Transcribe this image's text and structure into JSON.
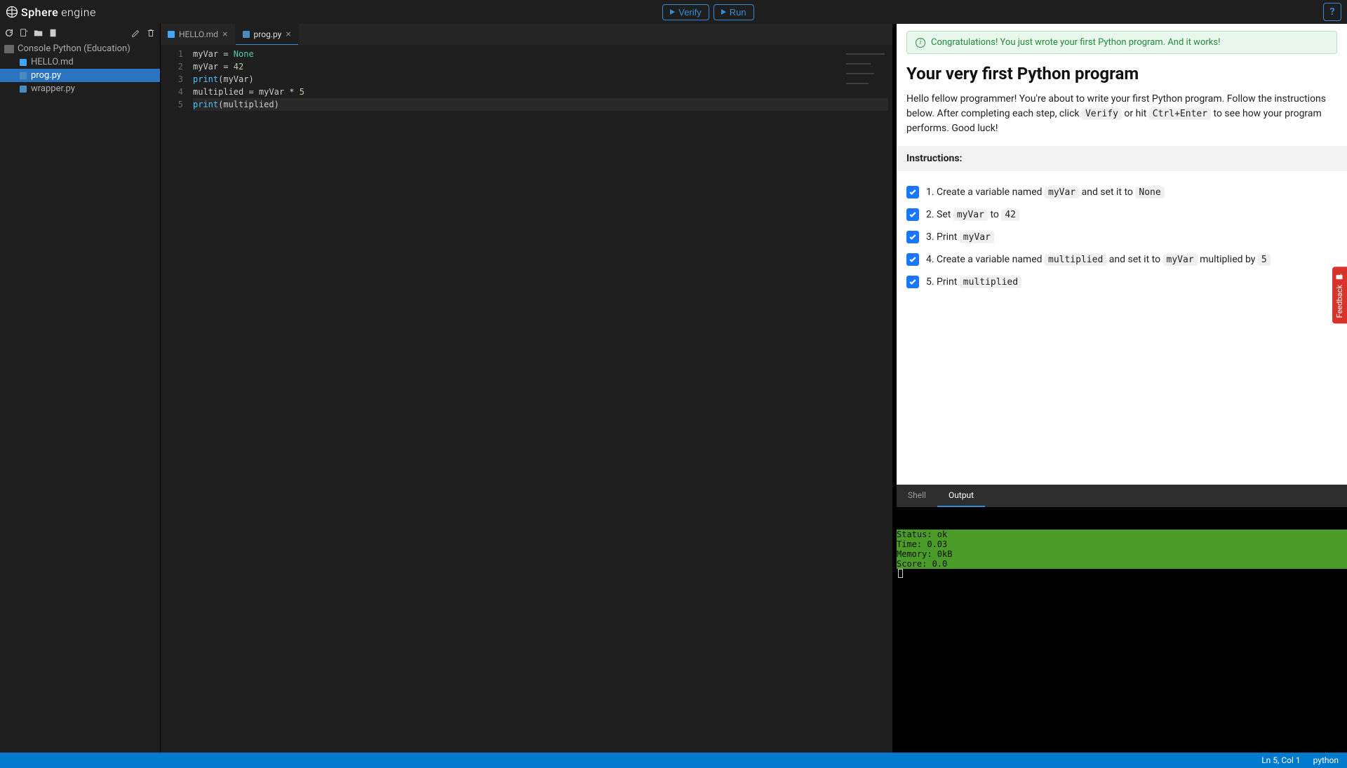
{
  "brand": {
    "name1": "Sphere",
    "name2": "engine"
  },
  "topbar": {
    "verify_label": "Verify",
    "run_label": "Run"
  },
  "sidebar": {
    "project_name": "Console Python (Education)",
    "files": [
      {
        "name": "HELLO.md",
        "icon": "markdown",
        "active": false
      },
      {
        "name": "prog.py",
        "icon": "python",
        "active": true
      },
      {
        "name": "wrapper.py",
        "icon": "python",
        "active": false
      }
    ]
  },
  "tabs": [
    {
      "label": "HELLO.md",
      "icon": "markdown",
      "active": false
    },
    {
      "label": "prog.py",
      "icon": "python",
      "active": true
    }
  ],
  "code_lines": [
    "myVar = None",
    "myVar = 42",
    "print(myVar)",
    "multiplied = myVar * 5",
    "print(multiplied)"
  ],
  "instructions": {
    "alert": "Congratulations! You just wrote your first Python program. And it works!",
    "title": "Your very first Python program",
    "intro_pre": "Hello fellow programmer! You're about to write your first Python program. Follow the instructions below. After completing each step, click ",
    "intro_kbd1": "Verify",
    "intro_mid": " or hit ",
    "intro_kbd2": "Ctrl+Enter",
    "intro_post": " to see how your program performs. Good luck!",
    "header": "Instructions:",
    "steps": [
      {
        "parts": [
          "1. Create a variable named ",
          "myVar",
          " and set it to ",
          "None"
        ]
      },
      {
        "parts": [
          "2. Set ",
          "myVar",
          " to ",
          "42"
        ]
      },
      {
        "parts": [
          "3. Print ",
          "myVar"
        ]
      },
      {
        "parts": [
          "4. Create a variable named ",
          "multiplied",
          " and set it to ",
          "myVar",
          " multiplied by ",
          "5"
        ]
      },
      {
        "parts": [
          "5. Print ",
          "multiplied"
        ]
      }
    ]
  },
  "output_tabs": {
    "shell": "Shell",
    "output": "Output"
  },
  "terminal": {
    "status_line": "Status: ok",
    "time_line": "Time: 0.03",
    "memory_line": "Memory: 0kB",
    "score_line": "Score: 0.0"
  },
  "statusbar": {
    "pos": "Ln 5, Col 1",
    "lang": "python"
  },
  "feedback_label": "Feedback"
}
